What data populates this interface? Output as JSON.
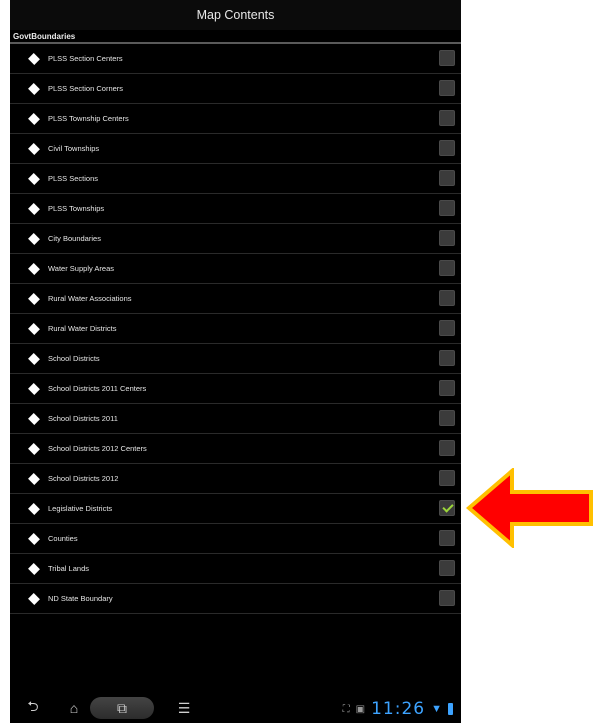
{
  "window": {
    "title": "Map Contents"
  },
  "section": {
    "title": "GovtBoundaries"
  },
  "layers": [
    {
      "label": "PLSS Section Centers",
      "checked": false
    },
    {
      "label": "PLSS Section Corners",
      "checked": false
    },
    {
      "label": "PLSS Township Centers",
      "checked": false
    },
    {
      "label": "Civil Townships",
      "checked": false
    },
    {
      "label": "PLSS Sections",
      "checked": false
    },
    {
      "label": "PLSS Townships",
      "checked": false
    },
    {
      "label": "City Boundaries",
      "checked": false
    },
    {
      "label": "Water Supply Areas",
      "checked": false
    },
    {
      "label": "Rural Water Associations",
      "checked": false
    },
    {
      "label": "Rural Water Districts",
      "checked": false
    },
    {
      "label": "School Districts",
      "checked": false
    },
    {
      "label": "School Districts 2011 Centers",
      "checked": false
    },
    {
      "label": "School Districts 2011",
      "checked": false
    },
    {
      "label": "School Districts 2012 Centers",
      "checked": false
    },
    {
      "label": "School Districts 2012",
      "checked": false
    },
    {
      "label": "Legislative Districts",
      "checked": true
    },
    {
      "label": "Counties",
      "checked": false
    },
    {
      "label": "Tribal Lands",
      "checked": false
    },
    {
      "label": "ND State Boundary",
      "checked": false
    }
  ],
  "status_bar": {
    "time": "11:26"
  },
  "icons": {
    "layer": "diamond-icon",
    "back": "back-icon",
    "home": "home-icon",
    "recent": "recent-apps-icon",
    "menu": "menu-icon",
    "screenshot": "screenshot-icon",
    "gallery": "gallery-icon",
    "wifi": "wifi-icon",
    "battery": "battery-icon",
    "pointer": "pointer-arrow-icon"
  },
  "colors": {
    "background": "#000000",
    "check": "#9cd63a",
    "clock": "#3da3ff",
    "arrow_fill": "#ff0000",
    "arrow_outline": "#ffc000"
  }
}
